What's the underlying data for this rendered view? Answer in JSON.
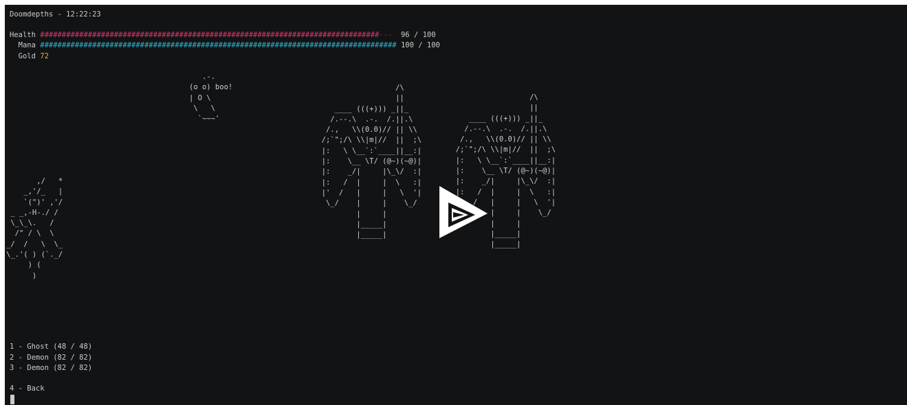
{
  "title": "Doomdepths - 12:22:23",
  "stats": {
    "health": {
      "label": "Health",
      "bar_filled": "##############################################################################",
      "bar_empty": "---",
      "value_text": " 96 / 100"
    },
    "mana": {
      "label": "  Mana",
      "bar_filled": "##################################################################################",
      "value_text": "100 / 100"
    },
    "gold": {
      "label": "  Gold",
      "value": "72"
    }
  },
  "art": {
    "ghost": "   .-.\n(o o) boo!\n| O \\\n \\   \\\n  `~~~'",
    "demon": "                   /\\\n                   ||\n     ____ (((+))) _||_\n    /.--.\\  .-.  /.||.\\\n   /.,   \\\\(0.0)// || \\\\\n  /;`\";/\\ \\\\|m|//  ||  ;\\\n  |:   \\ \\__`:`____||__:|\n  |:    \\__ \\T/ (@~)(~@)|\n  |:    _/|     |\\_\\/  :|\n  |:   /  |     |  \\   :|\n  |'  /   |     |   \\  '|\n   \\_/    |     |    \\_/\n          |     |\n          |_____|\n          |_____|",
    "player": "       ,/   *\n    _,'/_   |\n    `(\")' ,'/\n _ _,-H-./ /\n \\_\\_\\.   /\n  /\" / \\  \\\n_/  /   \\  \\_\n\\_.'( ) (`._/\n     ) (\n      )"
  },
  "menu": {
    "items": [
      "1 - Ghost (48 / 48)",
      "2 - Demon (82 / 82)",
      "3 - Demon (82 / 82)"
    ],
    "back": "4 - Back"
  },
  "colors": {
    "background": "#121314",
    "text": "#cccccc",
    "health": "#e0366e",
    "mana": "#2cb5d6",
    "gold": "#e8b23c"
  },
  "overlay": {
    "icon": "asciinema-play-icon"
  }
}
